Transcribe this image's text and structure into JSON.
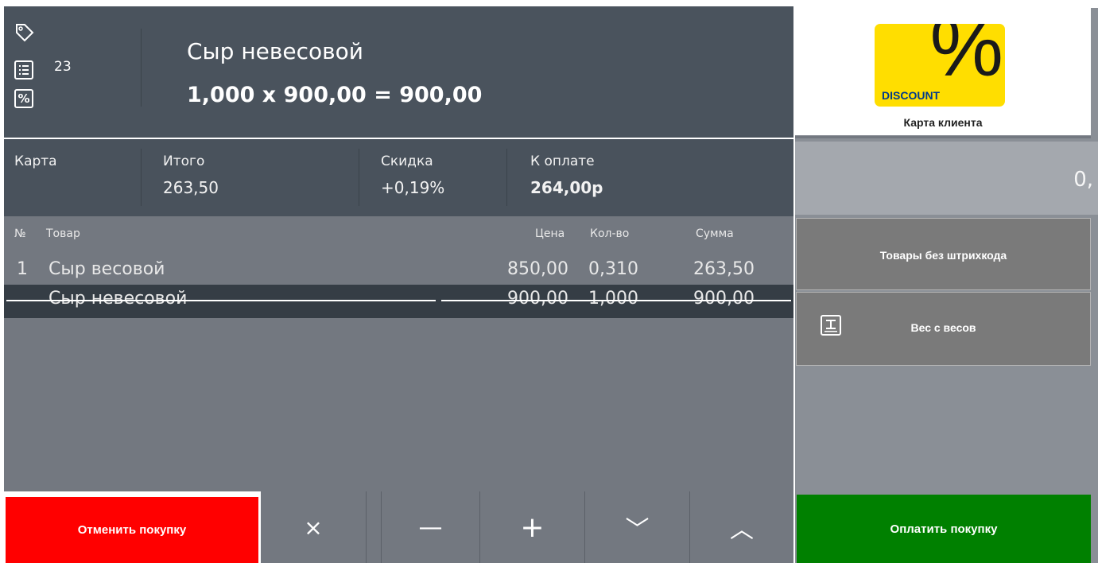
{
  "header": {
    "receipt_count": "23",
    "item_name": "Сыр невесовой",
    "item_calc": "1,000 x 900,00 = 900,00",
    "icons": [
      "tag-icon",
      "receipt-list-icon",
      "percent-icon"
    ]
  },
  "totals": {
    "card_label": "Карта",
    "total_label": "Итого",
    "total_value": "263,50",
    "discount_label": "Скидка",
    "discount_value": "+0,19%",
    "to_pay_label": "К оплате",
    "to_pay_value": "264,00р"
  },
  "table": {
    "columns": {
      "num": "№",
      "product": "Товар",
      "price": "Цена",
      "qty": "Кол-во",
      "sum": "Сумма"
    },
    "rows": [
      {
        "num": "1",
        "product": "Сыр весовой",
        "price": "850,00",
        "qty": "0,310",
        "sum": "263,50",
        "canceled": false
      },
      {
        "num": "",
        "product": "Сыр невесовой",
        "price": "900,00",
        "qty": "1,000",
        "sum": "900,00",
        "canceled": true
      }
    ]
  },
  "actions": {
    "cancel_purchase": "Отменить покупку",
    "delete_symbol": "×",
    "minus_symbol": "—",
    "plus_symbol": "+",
    "down_symbol": "﹀",
    "up_symbol": "︿",
    "pay": "Оплатить покупку"
  },
  "right_panel": {
    "discount_card_percent": "%",
    "discount_card_text": "DISCOUNT",
    "card_label": "Карта клиента",
    "amount_value": "0,",
    "no_barcode_button": "Товары без штрихкода",
    "scale_button": "Вес с весов"
  },
  "colors": {
    "header_bg": "#4a535d",
    "table_bg": "#737880",
    "selected_row": "#353d45",
    "cancel": "#ff0000",
    "pay": "#008000",
    "discount_card": "#ffde00"
  }
}
